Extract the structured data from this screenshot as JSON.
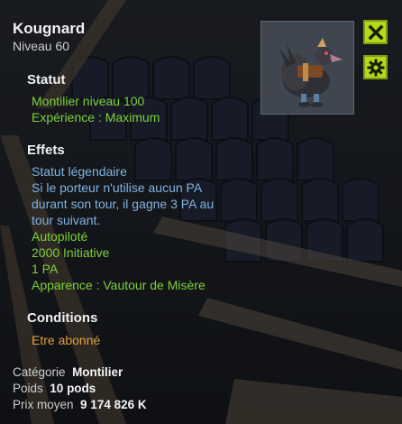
{
  "item": {
    "name": "Kougnard",
    "level_label": "Niveau",
    "level": "60"
  },
  "statut": {
    "title": "Statut",
    "lines": [
      "Montilier niveau 100",
      "Expérience : Maximum"
    ]
  },
  "effets": {
    "title": "Effets",
    "blue_lines": [
      "Statut légendaire",
      "Si le porteur n'utilise aucun PA",
      "durant son tour, il gagne 3 PA au",
      "tour suivant."
    ],
    "green_lines": [
      "Autopiloté",
      "2000 Initiative",
      "1 PA",
      "Apparence : Vautour de Misère"
    ]
  },
  "conditions": {
    "title": "Conditions",
    "lines": [
      "Etre abonné"
    ]
  },
  "footer": {
    "category_label": "Catégorie",
    "category": "Montilier",
    "weight_label": "Poids",
    "weight": "10 pods",
    "price_label": "Prix moyen",
    "price": "9 174 826 K"
  },
  "buttons": {
    "close_icon": "close-icon",
    "settings_icon": "gear-icon"
  },
  "colors": {
    "green": "#7ed13a",
    "blue": "#7fb3e2",
    "orange": "#e0a03a",
    "button": "#b3d91d"
  }
}
